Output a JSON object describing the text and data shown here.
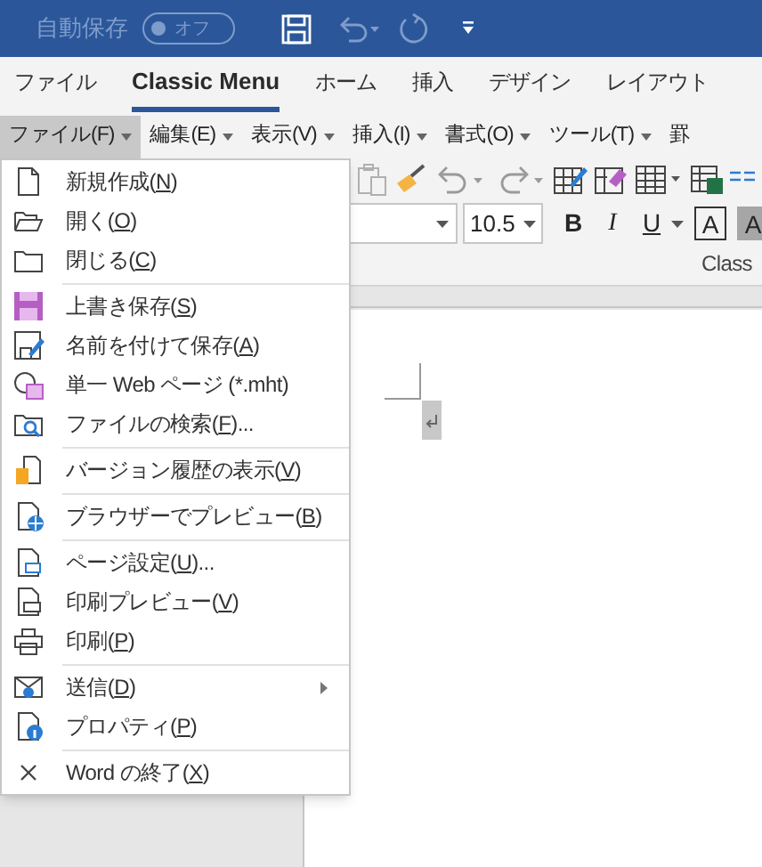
{
  "title_bar": {
    "autosave_label": "自動保存",
    "autosave_toggle": {
      "text": "オフ",
      "on": false
    }
  },
  "ribbon_tabs": [
    {
      "label": "ファイル",
      "selected": false
    },
    {
      "label": "Classic Menu",
      "selected": true
    },
    {
      "label": "ホーム",
      "selected": false
    },
    {
      "label": "挿入",
      "selected": false
    },
    {
      "label": "デザイン",
      "selected": false
    },
    {
      "label": "レイアウト",
      "selected": false
    }
  ],
  "classic_menu_bar": [
    {
      "label": "ファイル(F)",
      "selected": true,
      "has_dropdown": true
    },
    {
      "label": "編集(E)",
      "selected": false,
      "has_dropdown": true
    },
    {
      "label": "表示(V)",
      "selected": false,
      "has_dropdown": true
    },
    {
      "label": "挿入(I)",
      "selected": false,
      "has_dropdown": true
    },
    {
      "label": "書式(O)",
      "selected": false,
      "has_dropdown": true
    },
    {
      "label": "ツール(T)",
      "selected": false,
      "has_dropdown": true
    },
    {
      "label": "罫",
      "selected": false,
      "has_dropdown": false
    }
  ],
  "formatting": {
    "font_size": "10.5",
    "bold": "B",
    "italic": "I",
    "underline": "U",
    "char_border": "A",
    "char_shading": "A"
  },
  "group_label": "Class",
  "file_menu": [
    {
      "kind": "item",
      "label": [
        "新規作成(",
        "N",
        ")"
      ],
      "submenu": false
    },
    {
      "kind": "item",
      "label": [
        "開く(",
        "O",
        ")"
      ],
      "submenu": false
    },
    {
      "kind": "item",
      "label": [
        "閉じる(",
        "C",
        ")"
      ],
      "submenu": false
    },
    {
      "kind": "separator"
    },
    {
      "kind": "item",
      "label": [
        "上書き保存(",
        "S",
        ")"
      ],
      "submenu": false
    },
    {
      "kind": "item",
      "label": [
        "名前を付けて保存(",
        "A",
        ")"
      ],
      "submenu": false
    },
    {
      "kind": "item",
      "label": [
        "単一 Web ページ (*.mht)"
      ],
      "submenu": false
    },
    {
      "kind": "item",
      "label": [
        "ファイルの検索(",
        "F",
        ")..."
      ],
      "submenu": false
    },
    {
      "kind": "separator"
    },
    {
      "kind": "item",
      "label": [
        "バージョン履歴の表示(",
        "V",
        ")"
      ],
      "submenu": false
    },
    {
      "kind": "separator"
    },
    {
      "kind": "item",
      "label": [
        "ブラウザーでプレビュー(",
        "B",
        ")"
      ],
      "submenu": false
    },
    {
      "kind": "separator"
    },
    {
      "kind": "item",
      "label": [
        "ページ設定(",
        "U",
        ")..."
      ],
      "submenu": false
    },
    {
      "kind": "item",
      "label": [
        "印刷プレビュー(",
        "V",
        ")"
      ],
      "submenu": false
    },
    {
      "kind": "item",
      "label": [
        "印刷(",
        "P",
        ")"
      ],
      "submenu": false
    },
    {
      "kind": "separator"
    },
    {
      "kind": "item",
      "label": [
        "送信(",
        "D",
        ")"
      ],
      "submenu": true
    },
    {
      "kind": "item",
      "label": [
        "プロパティ(",
        "P",
        ")"
      ],
      "submenu": false
    },
    {
      "kind": "separator"
    },
    {
      "kind": "item",
      "label": [
        "Word の終了(",
        "X",
        ")"
      ],
      "submenu": false
    }
  ]
}
